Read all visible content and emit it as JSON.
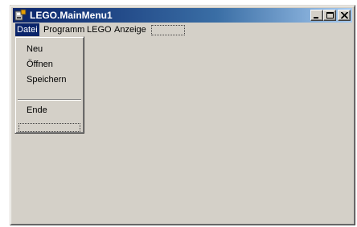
{
  "window": {
    "title": "LEGO.MainMenu1",
    "caption_buttons": [
      "minimize-icon",
      "maximize-icon",
      "close-icon"
    ]
  },
  "menubar": {
    "items": [
      {
        "label": "Datei",
        "active": true
      },
      {
        "label": "Programm"
      },
      {
        "label": "LEGO"
      },
      {
        "label": "Anzeige"
      }
    ]
  },
  "dropdown": {
    "items": [
      {
        "label": "Neu"
      },
      {
        "label": "Öffnen"
      },
      {
        "label": "Speichern"
      },
      {
        "label": "Ende"
      }
    ]
  },
  "colors": {
    "titlebar_start": "#0a246a",
    "titlebar_end": "#a6caf0",
    "face": "#d4d0c8",
    "highlight": "#0a246a"
  }
}
